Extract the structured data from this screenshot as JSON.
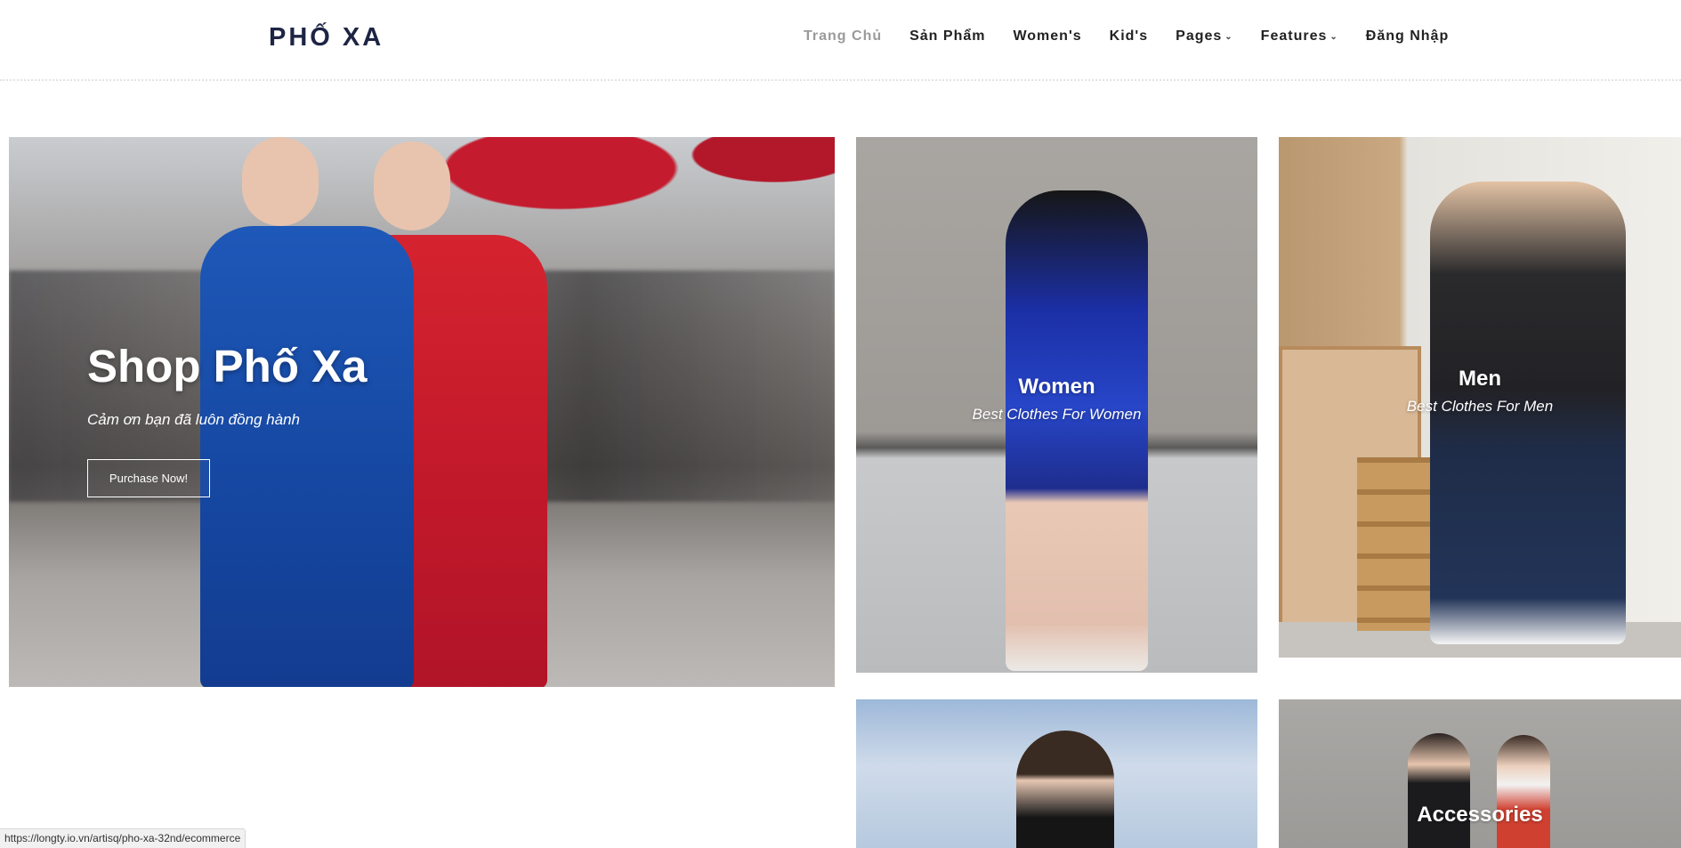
{
  "header": {
    "logo": "PHỐ XA",
    "nav": [
      {
        "label": "Trang Chủ",
        "active": true,
        "dropdown": false
      },
      {
        "label": "Sản Phẩm",
        "active": false,
        "dropdown": false
      },
      {
        "label": "Women's",
        "active": false,
        "dropdown": false
      },
      {
        "label": "Kid's",
        "active": false,
        "dropdown": false
      },
      {
        "label": "Pages",
        "active": false,
        "dropdown": true
      },
      {
        "label": "Features",
        "active": false,
        "dropdown": true
      },
      {
        "label": "Đăng Nhập",
        "active": false,
        "dropdown": false
      }
    ]
  },
  "hero": {
    "title": "Shop Phố Xa",
    "subtitle": "Cảm ơn bạn đã luôn đồng hành",
    "button": "Purchase Now!"
  },
  "tiles": {
    "women": {
      "title": "Women",
      "subtitle": "Best Clothes For Women"
    },
    "men": {
      "title": "Men",
      "subtitle": "Best Clothes For Men"
    },
    "accessories": {
      "title": "Accessories"
    }
  },
  "status_url": "https://longty.io.vn/artisq/pho-xa-32nd/ecommerce",
  "colors": {
    "logo": "#1d2444",
    "nav_active": "#9a9a9a",
    "nav": "#222222"
  }
}
